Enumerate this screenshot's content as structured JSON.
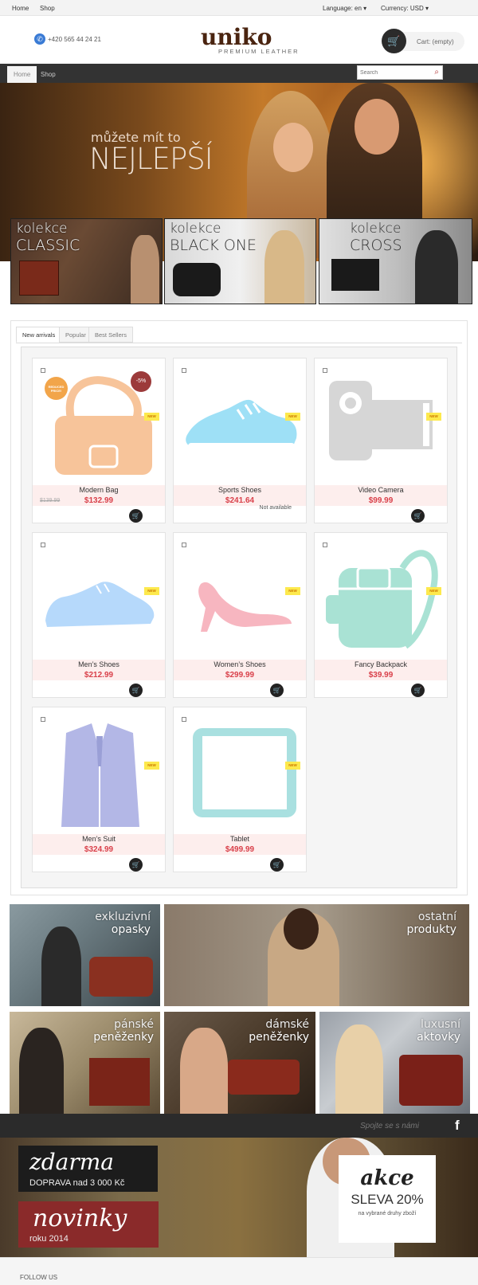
{
  "topbar": {
    "home": "Home",
    "shop": "Shop",
    "language": "Language: en",
    "currency": "Currency: USD"
  },
  "header": {
    "phone": "+420 565 44 24 21",
    "logo": "uniko",
    "logo_sub": "PREMIUM LEATHER",
    "cart": "Cart: (empty)"
  },
  "nav": {
    "home": "Home",
    "shop": "Shop",
    "search_placeholder": "Search"
  },
  "hero": {
    "line1": "můžete mít to",
    "line2": "NEJLEPŠÍ"
  },
  "collections": [
    {
      "t1": "kolekce",
      "t2": "CLASSIC"
    },
    {
      "t1": "kolekce",
      "t2": "BLACK ONE"
    },
    {
      "t1": "kolekce",
      "t2": "CROSS"
    }
  ],
  "tabs": [
    "New arrivals",
    "Popular",
    "Best Sellers"
  ],
  "products": [
    {
      "name": "Modern Bag",
      "price": "$132.99",
      "old_price": "$139.99",
      "discount": "-5%",
      "sticker": "REDUCED PRICE!",
      "badge": "NEW",
      "color": "#f7c49a",
      "icon": "bag-icon"
    },
    {
      "name": "Sports Shoes",
      "price": "$241.64",
      "availability": "Not available",
      "badge": "NEW",
      "color": "#9ee0f6",
      "icon": "sneaker-icon"
    },
    {
      "name": "Video Camera",
      "price": "$99.99",
      "badge": "NEW",
      "color": "#d6d6d6",
      "icon": "camera-icon"
    },
    {
      "name": "Men’s Shoes",
      "price": "$212.99",
      "badge": "NEW",
      "color": "#b6d9fb",
      "icon": "shoe-icon"
    },
    {
      "name": "Women’s Shoes",
      "price": "$299.99",
      "badge": "NEW",
      "color": "#f7b6c0",
      "icon": "heel-icon"
    },
    {
      "name": "Fancy Backpack",
      "price": "$39.99",
      "badge": "NEW",
      "color": "#a9e2d4",
      "icon": "backpack-icon"
    },
    {
      "name": "Men’s Suit",
      "price": "$324.99",
      "badge": "NEW",
      "color": "#b3b7e6",
      "icon": "suit-icon"
    },
    {
      "name": "Tablet",
      "price": "$499.99",
      "badge": "NEW",
      "color": "#a9e0e0",
      "icon": "tablet-icon"
    }
  ],
  "promos": [
    {
      "l1": "exkluzivní",
      "l2": "opasky"
    },
    {
      "l1": "ostatní",
      "l2": "produkty"
    },
    {
      "l1": "pánské",
      "l2": "peněženky"
    },
    {
      "l1": "dámské",
      "l2": "peněženky"
    },
    {
      "l1": "luxusní",
      "l2": "aktovky"
    }
  ],
  "connect": {
    "label": "Spojte se s námi"
  },
  "banner": {
    "z1": "zdarma",
    "z2": "DOPRAVA nad 3 000 Kč",
    "n1": "novinky",
    "n2": "roku 2014",
    "a1": "akce",
    "a2": "SLEVA 20%",
    "a3": "na vybrané druhy zboží"
  },
  "footer": {
    "follow": "FOLLOW US"
  },
  "colors": {
    "accent": "#d9404a",
    "dark": "#333333",
    "badge": "#fde94d"
  }
}
